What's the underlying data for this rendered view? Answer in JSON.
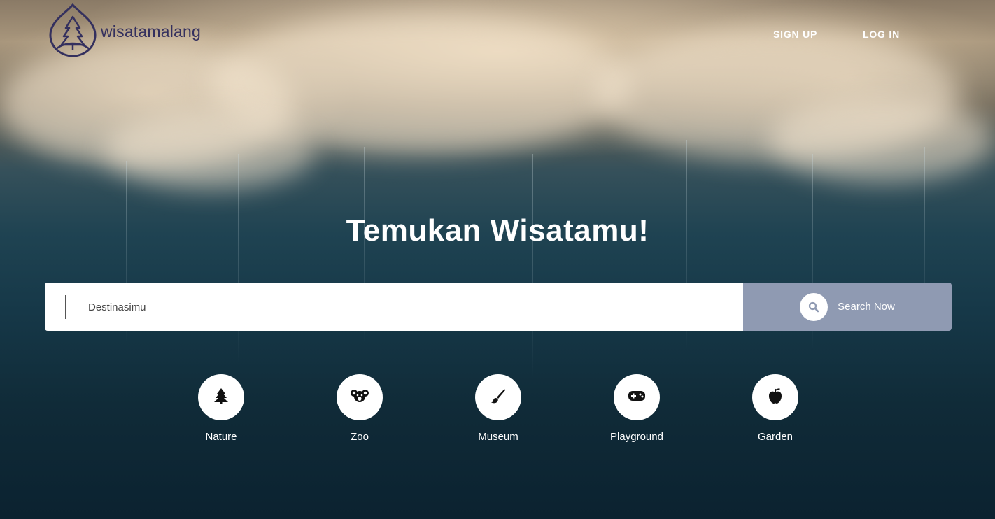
{
  "brand": {
    "name": "wisatamalang",
    "logo_icon": "pine-tree-drop-icon",
    "logo_color": "#34305e"
  },
  "nav": {
    "signup_label": "SIGN UP",
    "login_label": "LOG IN"
  },
  "hero": {
    "headline": "Temukan Wisatamu!"
  },
  "search": {
    "placeholder": "Destinasimu",
    "button_label": "Search Now",
    "button_icon": "search-icon",
    "button_color": "#8f9ab2"
  },
  "categories": [
    {
      "label": "Nature",
      "icon": "tree-icon"
    },
    {
      "label": "Zoo",
      "icon": "koala-icon"
    },
    {
      "label": "Museum",
      "icon": "paintbrush-icon"
    },
    {
      "label": "Playground",
      "icon": "gamepad-icon"
    },
    {
      "label": "Garden",
      "icon": "apple-icon"
    }
  ]
}
